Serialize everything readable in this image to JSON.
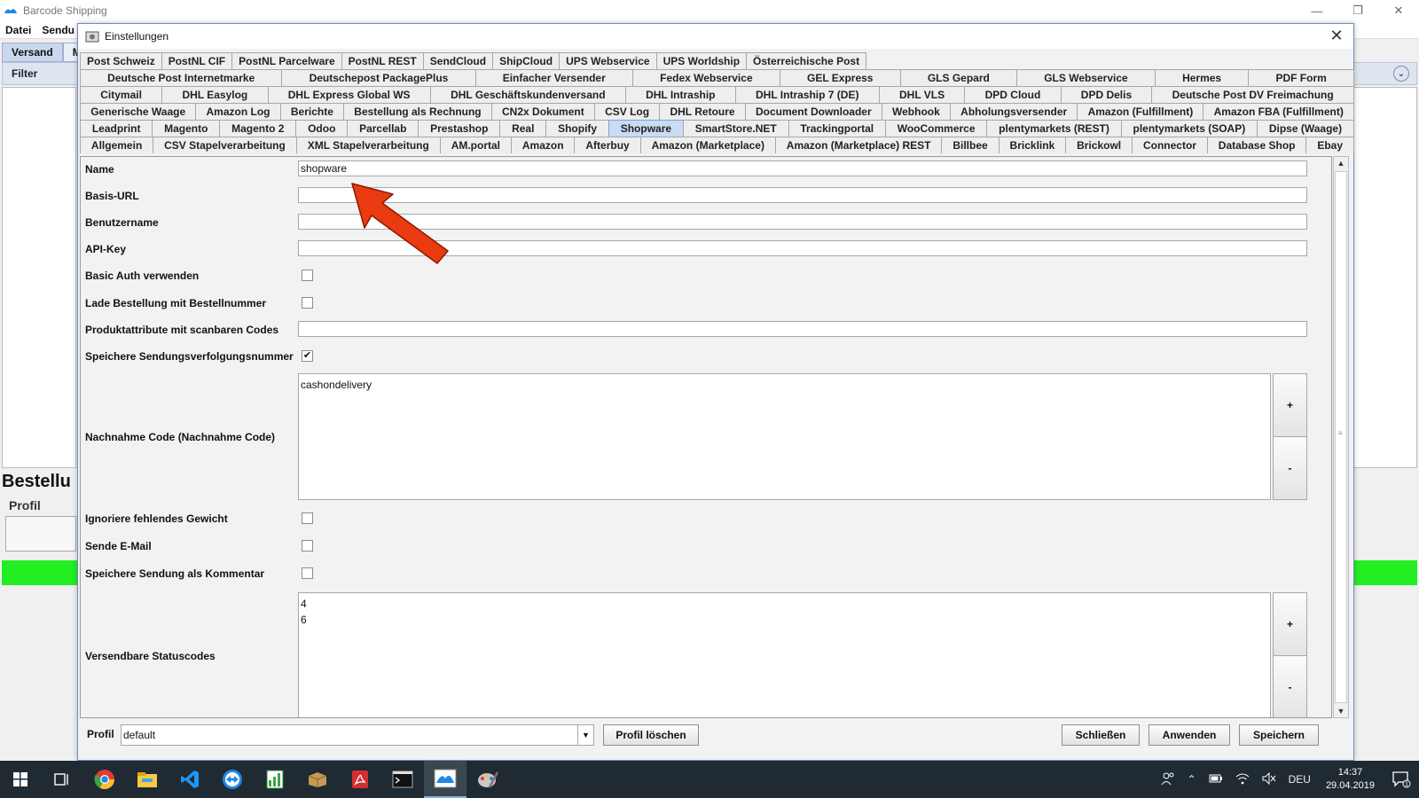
{
  "app": {
    "title": "Barcode Shipping",
    "menu": [
      "Datei",
      "Sendu"
    ],
    "tabs": [
      "Versand",
      "M"
    ],
    "filter_label": "Filter",
    "heading": "Bestellu",
    "profil_label": "Profil"
  },
  "dialog": {
    "title": "Einstellungen",
    "tab_rows": [
      [
        "Post Schweiz",
        "PostNL CIF",
        "PostNL Parcelware",
        "PostNL REST",
        "SendCloud",
        "ShipCloud",
        "UPS Webservice",
        "UPS Worldship",
        "Österreichische Post"
      ],
      [
        "Deutsche Post Internetmarke",
        "Deutschepost PackagePlus",
        "Einfacher Versender",
        "Fedex Webservice",
        "GEL Express",
        "GLS Gepard",
        "GLS Webservice",
        "Hermes",
        "PDF Form"
      ],
      [
        "Citymail",
        "DHL Easylog",
        "DHL Express Global WS",
        "DHL Geschäftskundenversand",
        "DHL Intraship",
        "DHL Intraship 7 (DE)",
        "DHL VLS",
        "DPD Cloud",
        "DPD Delis",
        "Deutsche Post DV Freimachung"
      ],
      [
        "Generische Waage",
        "Amazon Log",
        "Berichte",
        "Bestellung als Rechnung",
        "CN2x Dokument",
        "CSV Log",
        "DHL Retoure",
        "Document Downloader",
        "Webhook",
        "Abholungsversender",
        "Amazon (Fulfillment)",
        "Amazon FBA (Fulfillment)"
      ],
      [
        "Leadprint",
        "Magento",
        "Magento 2",
        "Odoo",
        "Parcellab",
        "Prestashop",
        "Real",
        "Shopify",
        "Shopware",
        "SmartStore.NET",
        "Trackingportal",
        "WooCommerce",
        "plentymarkets (REST)",
        "plentymarkets (SOAP)",
        "Dipse (Waage)"
      ],
      [
        "Allgemein",
        "CSV Stapelverarbeitung",
        "XML Stapelverarbeitung",
        "AM.portal",
        "Amazon",
        "Afterbuy",
        "Amazon (Marketplace)",
        "Amazon (Marketplace) REST",
        "Billbee",
        "Bricklink",
        "Brickowl",
        "Connector",
        "Database Shop",
        "Ebay"
      ]
    ],
    "active_tab": "Shopware",
    "fields": {
      "name_label": "Name",
      "name_value": "shopware",
      "base_url_label": "Basis-URL",
      "base_url_value": "",
      "username_label": "Benutzername",
      "username_value": "",
      "api_key_label": "API-Key",
      "api_key_value": "",
      "basic_auth_label": "Basic Auth verwenden",
      "basic_auth_checked": false,
      "load_by_ordernr_label": "Lade Bestellung mit Bestellnummer",
      "load_by_ordernr_checked": false,
      "product_attr_label": "Produktattribute mit scanbaren Codes",
      "product_attr_value": "",
      "save_tracking_label": "Speichere Sendungsverfolgungsnummer",
      "save_tracking_checked": true,
      "cod_label": "Nachnahme Code (Nachnahme Code)",
      "cod_items": [
        "cashondelivery"
      ],
      "ignore_weight_label": "Ignoriere fehlendes Gewicht",
      "ignore_weight_checked": false,
      "send_email_label": "Sende E-Mail",
      "send_email_checked": false,
      "save_comment_label": "Speichere Sendung als Kommentar",
      "save_comment_checked": false,
      "status_codes_label": "Versendbare Statuscodes",
      "status_codes_items": [
        "4",
        "6"
      ],
      "add_label": "+",
      "remove_label": "-"
    },
    "bottom": {
      "profil_label": "Profil",
      "profil_value": "default",
      "delete_profile": "Profil löschen",
      "close": "Schließen",
      "apply": "Anwenden",
      "save": "Speichern"
    }
  },
  "taskbar": {
    "language": "DEU",
    "time": "14:37",
    "date": "29.04.2019",
    "notification_count": "1"
  },
  "colors": {
    "active_tab": "#c9dcf3",
    "status_green": "#22ee22",
    "arrow": "#ea3a0f"
  }
}
